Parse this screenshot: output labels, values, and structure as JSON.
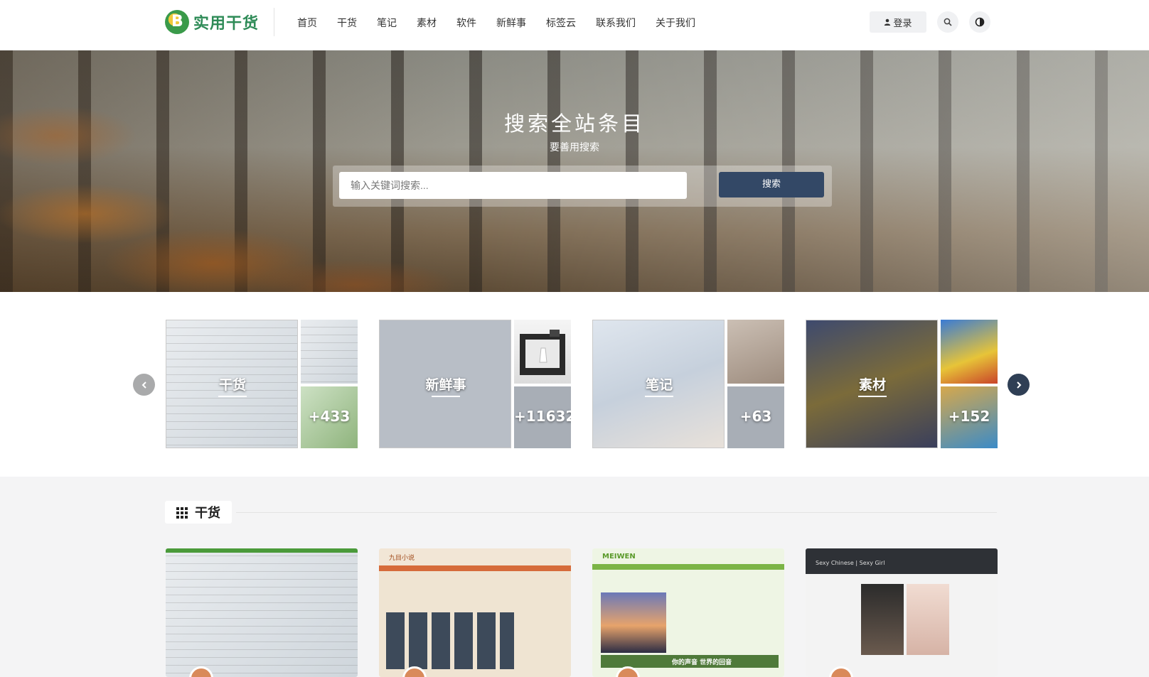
{
  "brand": {
    "name": "实用干货"
  },
  "nav": {
    "items": [
      "首页",
      "干货",
      "笔记",
      "素材",
      "软件",
      "新鲜事",
      "标签云",
      "联系我们",
      "关于我们"
    ]
  },
  "header": {
    "login_label": "登录"
  },
  "hero": {
    "title": "搜索全站条目",
    "subtitle": "要善用搜索",
    "search_placeholder": "输入关键词搜索...",
    "search_button": "搜索"
  },
  "categories": [
    {
      "name": "干货",
      "count": "+433"
    },
    {
      "name": "新鲜事",
      "count": "+11632"
    },
    {
      "name": "笔记",
      "count": "+63"
    },
    {
      "name": "素材",
      "count": "+152"
    }
  ],
  "section": {
    "title": "干货"
  },
  "post_thumbs": {
    "card4_header": "Sexy Chinese | Sexy Girl",
    "card2_header": "九目小说",
    "card3_logo": "MEIWEN",
    "card3_banner": "你的声音 世界的回音"
  }
}
